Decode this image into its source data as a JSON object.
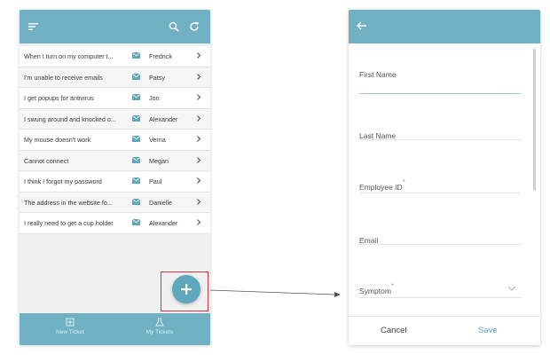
{
  "left_screen": {
    "tickets": [
      {
        "subject": "When I turn on my computer t...",
        "name": "Fredrick"
      },
      {
        "subject": "I'm unable to receive emails",
        "name": "Patsy"
      },
      {
        "subject": "I get popups for antivirus",
        "name": "Jon"
      },
      {
        "subject": "I swung around and knocked o...",
        "name": "Alexander"
      },
      {
        "subject": "My mouse doesn't work",
        "name": "Verna"
      },
      {
        "subject": "Cannot connect",
        "name": "Megan"
      },
      {
        "subject": "I think I forgot my password",
        "name": "Paul"
      },
      {
        "subject": "The address in the website fo...",
        "name": "Danielle"
      },
      {
        "subject": "I really need to get a cup holder",
        "name": "Alexander"
      }
    ],
    "nav": {
      "new_ticket": "New Ticket",
      "my_tickets": "My Tickets"
    },
    "icons": {
      "menu": "menu-icon",
      "search": "search-icon",
      "refresh": "refresh-icon",
      "mail": "mail-icon",
      "chevron": "chevron-right-icon",
      "add": "plus-icon"
    }
  },
  "right_screen": {
    "fields": {
      "first_name": "First Name",
      "last_name": "Last Name",
      "employee_id": "Employee ID",
      "email": "Email",
      "symptom": "Symptom"
    },
    "required_mark": "*",
    "actions": {
      "cancel": "Cancel",
      "save": "Save"
    }
  },
  "colors": {
    "header": "#6fb0c3",
    "accent": "#5fa7bd",
    "highlight": "#d9363e"
  }
}
